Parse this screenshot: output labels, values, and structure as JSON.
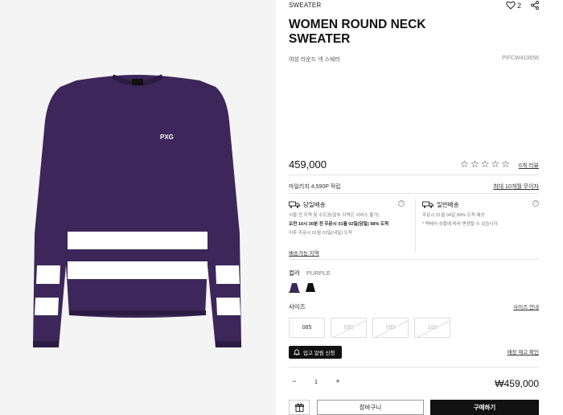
{
  "product": {
    "category": "SWEATER",
    "like_count": "2",
    "title": "WOMEN ROUND NECK SWEATER",
    "subtitle_ko": "여성 라운드 넥 스웨터",
    "code": "PIFCW410656",
    "brand_mark": "PXG",
    "price": "459,000",
    "rating_stars": 0,
    "review_link": "0개 리뷰",
    "mileage": "마일리지 4,590P 적립",
    "installment": "최대 10개월 무이자"
  },
  "shipping": {
    "same_day": {
      "title": "당일배송",
      "lines": [
        "서울 전 지역 및 수도권(일부 지역은 서비스 불가)",
        "오전 10시 30분 전 주문시 01월 02일(당일) 98% 도착",
        "이후 주문시 01월 03일(내일) 도착"
      ]
    },
    "standard": {
      "title": "일반배송",
      "lines": [
        "주문시 01월 04일 89% 도착 예상",
        "* 택배사 상황에 따라 변경될 수 있습니다."
      ]
    },
    "area_link": "배송가능 지역"
  },
  "color": {
    "label": "컬러",
    "selected": "PURPLE",
    "swatches": [
      {
        "name": "purple",
        "color": "#3d2659"
      },
      {
        "name": "black",
        "color": "#111111"
      }
    ]
  },
  "size": {
    "label": "사이즈",
    "guide": "사이즈 안내",
    "options": [
      {
        "label": "085",
        "available": true
      },
      {
        "label": "090",
        "available": false
      },
      {
        "label": "095",
        "available": false
      },
      {
        "label": "100",
        "available": false
      }
    ]
  },
  "restock": {
    "button": "입고 알림 신청",
    "info_link": "매장 재고 확인"
  },
  "purchase": {
    "qty_minus": "−",
    "qty_value": "1",
    "qty_plus": "+",
    "total": "₩459,000",
    "cart": "장바구니",
    "buy": "구매하기"
  },
  "colors": {
    "accent": "#111111",
    "sweater": "#3d2659"
  }
}
